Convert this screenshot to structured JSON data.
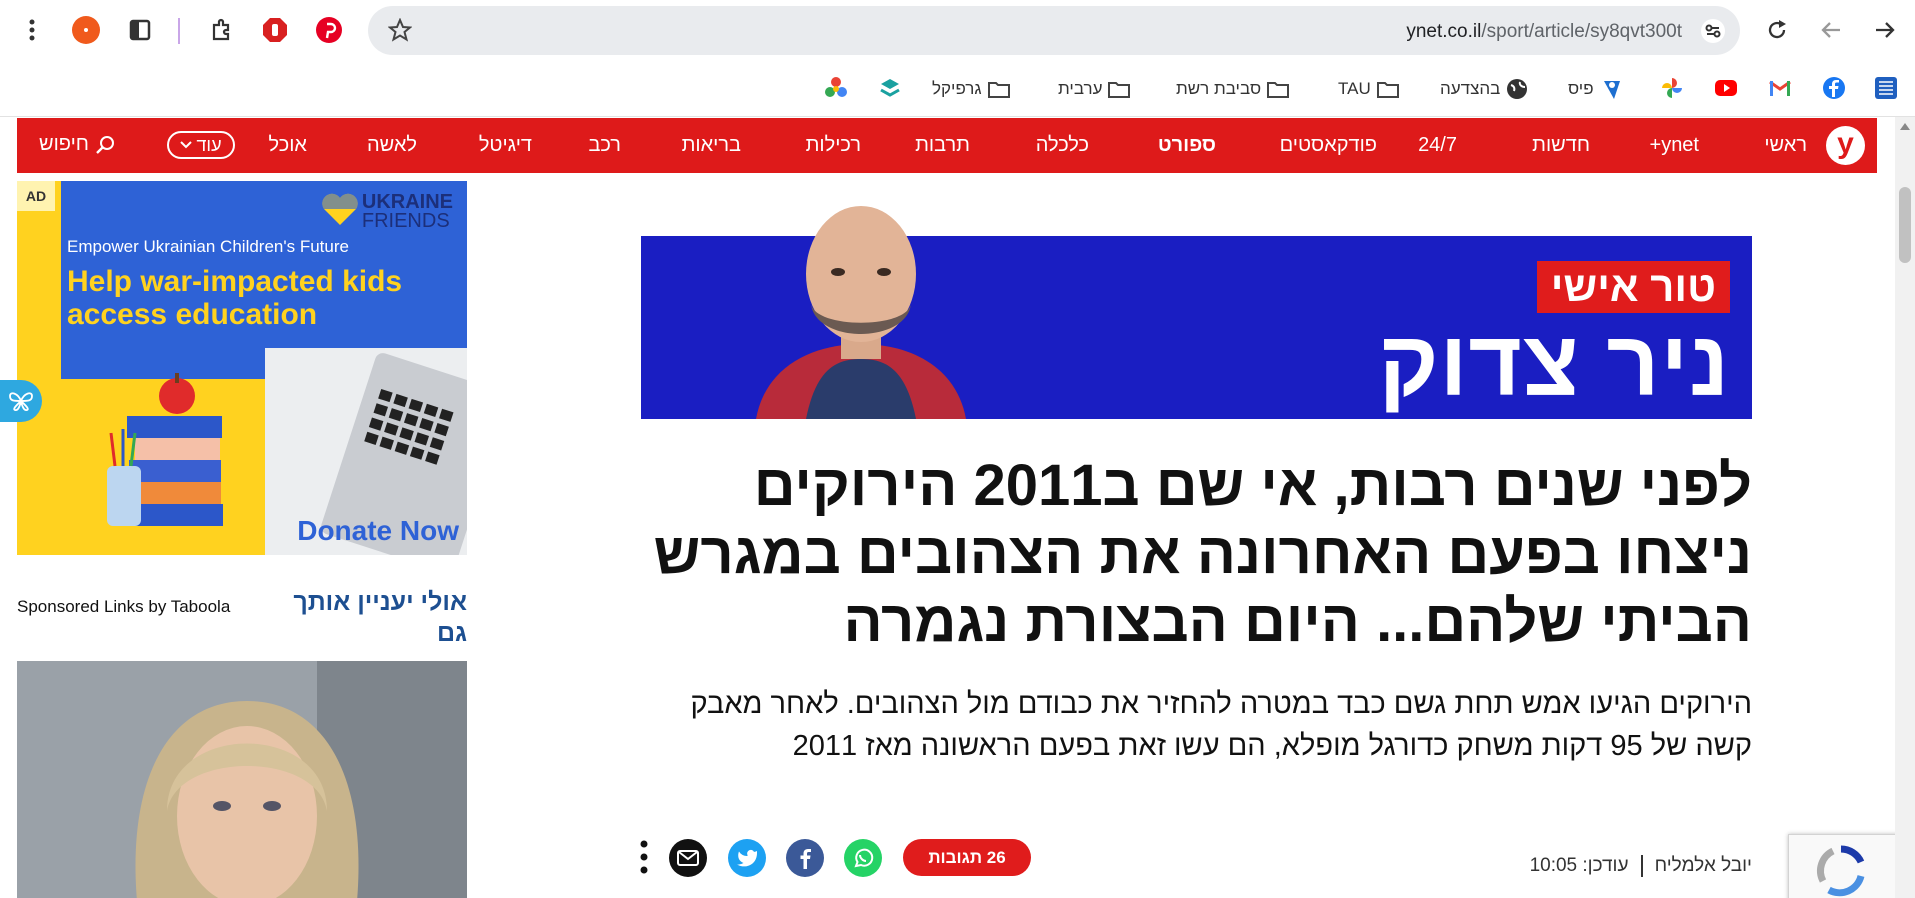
{
  "browser": {
    "url_domain": "ynet.co.il",
    "url_path": "/sport/article/sy8qvt300t",
    "bookmarks": [
      {
        "label": "גרפיקל",
        "icon": "folder-icon"
      },
      {
        "label": "ערבית",
        "icon": "folder-icon"
      },
      {
        "label": "סביבת רשת",
        "icon": "folder-icon"
      },
      {
        "label": "TAU",
        "icon": "folder-icon"
      },
      {
        "label": "בהצדעה",
        "icon": "globe-icon"
      },
      {
        "label": "פיס",
        "icon": "pais-icon"
      }
    ]
  },
  "nav": {
    "logo": "y",
    "items": [
      "ראשי",
      "ynet+",
      "חדשות",
      "24/7",
      "פודקאסטים",
      "ספורט",
      "כלכלה",
      "תרבות",
      "רכילות",
      "בריאות",
      "רכב",
      "דיגיטל",
      "לאשה",
      "אוכל"
    ],
    "bold_item": "ספורט",
    "more": "עוד",
    "search": "חיפוש"
  },
  "ad": {
    "badge": "AD",
    "brand_line1": "UKRAINE",
    "brand_line2": "FRIENDS",
    "tagline": "Empower Ukrainian Children's Future",
    "headline": "Help war-impacted kids access education",
    "cta": "Donate Now"
  },
  "taboola": {
    "title": "אולי יעניין אותך גם",
    "by": "Sponsored Links by Taboola"
  },
  "article": {
    "banner_tag": "טור אישי",
    "banner_name": "ניר צדוק",
    "headline": "לפני שנים רבות, אי שם ב2011 הירוקים ניצחו בפעם האחרונה את הצהובים במגרש הביתי שלהם... היום הבצורת נגמרה",
    "subtitle": "הירוקים הגיעו אמש תחת גשם כבד במטרה להחזיר את כבודם מול הצהובים. לאחר מאבק קשה של 95 דקות משחק כדורגל מופלא, הם עשו זאת בפעם הראשונה מאז 2011",
    "author": "יובל אלמליח",
    "updated": "עודכן: 10:05",
    "comments": "26 תגובות"
  },
  "colors": {
    "brand_red": "#de1a1a",
    "banner_blue": "#1a1ec2",
    "ad_blue": "#2e62d6",
    "ad_yellow": "#ffd21f",
    "taboola_blue": "#1d4f91"
  }
}
